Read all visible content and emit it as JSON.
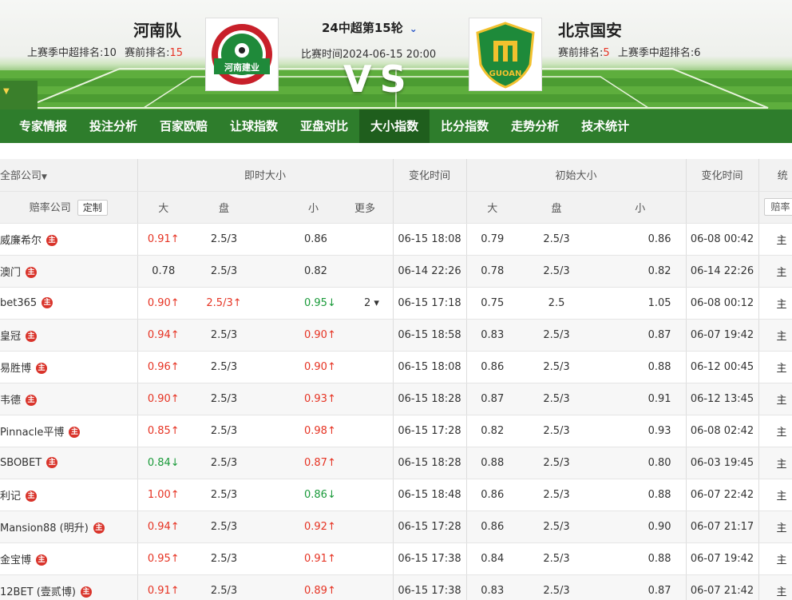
{
  "header": {
    "home": {
      "name": "河南队",
      "rank_label": "上赛季中超排名:",
      "rank_value": "10",
      "pre_label": "赛前排名:",
      "pre_value": "15",
      "logo_text": "河南建业"
    },
    "away": {
      "name": "北京国安",
      "pre_label": "赛前排名:",
      "pre_value": "5",
      "rank_label": "上赛季中超排名:",
      "rank_value": "6",
      "logo_text": "GUOAN"
    },
    "round": "24中超第15轮",
    "match_time_label": "比赛时间",
    "match_time": "2024-06-15 20:00",
    "vs": "VS"
  },
  "nav": [
    "专家情报",
    "投注分析",
    "百家欧赔",
    "让球指数",
    "亚盘对比",
    "大小指数",
    "比分指数",
    "走势分析",
    "技术统计"
  ],
  "nav_active": 5,
  "table": {
    "group_headers": {
      "all_companies": "全部公司",
      "live": "即时大小",
      "change_time": "变化时间",
      "initial": "初始大小",
      "change_time2": "变化时间",
      "more_col": "统"
    },
    "sub_headers": {
      "company": "赔率公司",
      "custom": "定制",
      "big": "大",
      "line": "盘",
      "small": "小",
      "more": "更多",
      "big2": "大",
      "line2": "盘",
      "small2": "小",
      "filter": "赔率"
    },
    "rows": [
      {
        "company": "威廉希尔",
        "live_big": "0.91↑",
        "live_big_dir": "up",
        "live_line": "2.5/3",
        "live_line_dir": "",
        "live_small": "0.86",
        "live_small_dir": "",
        "more": "",
        "time": "06-15 18:08",
        "init_big": "0.79",
        "init_line": "2.5/3",
        "init_small": "0.86",
        "init_time": "06-08 00:42",
        "tail": "主"
      },
      {
        "company": "澳门",
        "live_big": "0.78",
        "live_big_dir": "",
        "live_line": "2.5/3",
        "live_line_dir": "",
        "live_small": "0.82",
        "live_small_dir": "",
        "more": "",
        "time": "06-14 22:26",
        "init_big": "0.78",
        "init_line": "2.5/3",
        "init_small": "0.82",
        "init_time": "06-14 22:26",
        "tail": "主"
      },
      {
        "company": "bet365",
        "live_big": "0.90↑",
        "live_big_dir": "up",
        "live_line": "2.5/3↑",
        "live_line_dir": "up",
        "live_small": "0.95↓",
        "live_small_dir": "dn",
        "more": "2 ▾",
        "time": "06-15 17:18",
        "init_big": "0.75",
        "init_line": "2.5",
        "init_small": "1.05",
        "init_time": "06-08 00:12",
        "tail": "主"
      },
      {
        "company": "皇冠",
        "live_big": "0.94↑",
        "live_big_dir": "up",
        "live_line": "2.5/3",
        "live_line_dir": "",
        "live_small": "0.90↑",
        "live_small_dir": "up",
        "more": "",
        "time": "06-15 18:58",
        "init_big": "0.83",
        "init_line": "2.5/3",
        "init_small": "0.87",
        "init_time": "06-07 19:42",
        "tail": "主"
      },
      {
        "company": "易胜博",
        "live_big": "0.96↑",
        "live_big_dir": "up",
        "live_line": "2.5/3",
        "live_line_dir": "",
        "live_small": "0.90↑",
        "live_small_dir": "up",
        "more": "",
        "time": "06-15 18:08",
        "init_big": "0.86",
        "init_line": "2.5/3",
        "init_small": "0.88",
        "init_time": "06-12 00:45",
        "tail": "主"
      },
      {
        "company": "韦德",
        "live_big": "0.90↑",
        "live_big_dir": "up",
        "live_line": "2.5/3",
        "live_line_dir": "",
        "live_small": "0.93↑",
        "live_small_dir": "up",
        "more": "",
        "time": "06-15 18:28",
        "init_big": "0.87",
        "init_line": "2.5/3",
        "init_small": "0.91",
        "init_time": "06-12 13:45",
        "tail": "主"
      },
      {
        "company": "Pinnacle平博",
        "live_big": "0.85↑",
        "live_big_dir": "up",
        "live_line": "2.5/3",
        "live_line_dir": "",
        "live_small": "0.98↑",
        "live_small_dir": "up",
        "more": "",
        "time": "06-15 17:28",
        "init_big": "0.82",
        "init_line": "2.5/3",
        "init_small": "0.93",
        "init_time": "06-08 02:42",
        "tail": "主"
      },
      {
        "company": "SBOBET",
        "live_big": "0.84↓",
        "live_big_dir": "dn",
        "live_line": "2.5/3",
        "live_line_dir": "",
        "live_small": "0.87↑",
        "live_small_dir": "up",
        "more": "",
        "time": "06-15 18:28",
        "init_big": "0.88",
        "init_line": "2.5/3",
        "init_small": "0.80",
        "init_time": "06-03 19:45",
        "tail": "主"
      },
      {
        "company": "利记",
        "live_big": "1.00↑",
        "live_big_dir": "up",
        "live_line": "2.5/3",
        "live_line_dir": "",
        "live_small": "0.86↓",
        "live_small_dir": "dn",
        "more": "",
        "time": "06-15 18:48",
        "init_big": "0.86",
        "init_line": "2.5/3",
        "init_small": "0.88",
        "init_time": "06-07 22:42",
        "tail": "主"
      },
      {
        "company": "Mansion88 (明升)",
        "live_big": "0.94↑",
        "live_big_dir": "up",
        "live_line": "2.5/3",
        "live_line_dir": "",
        "live_small": "0.92↑",
        "live_small_dir": "up",
        "more": "",
        "time": "06-15 17:28",
        "init_big": "0.86",
        "init_line": "2.5/3",
        "init_small": "0.90",
        "init_time": "06-07 21:17",
        "tail": "主"
      },
      {
        "company": "金宝博",
        "live_big": "0.95↑",
        "live_big_dir": "up",
        "live_line": "2.5/3",
        "live_line_dir": "",
        "live_small": "0.91↑",
        "live_small_dir": "up",
        "more": "",
        "time": "06-15 17:38",
        "init_big": "0.84",
        "init_line": "2.5/3",
        "init_small": "0.88",
        "init_time": "06-07 19:42",
        "tail": "主"
      },
      {
        "company": "12BET (壹贰博)",
        "live_big": "0.91↑",
        "live_big_dir": "up",
        "live_line": "2.5/3",
        "live_line_dir": "",
        "live_small": "0.89↑",
        "live_small_dir": "up",
        "more": "",
        "time": "06-15 17:38",
        "init_big": "0.83",
        "init_line": "2.5/3",
        "init_small": "0.87",
        "init_time": "06-07 21:42",
        "tail": "主"
      }
    ],
    "badge": "主"
  }
}
